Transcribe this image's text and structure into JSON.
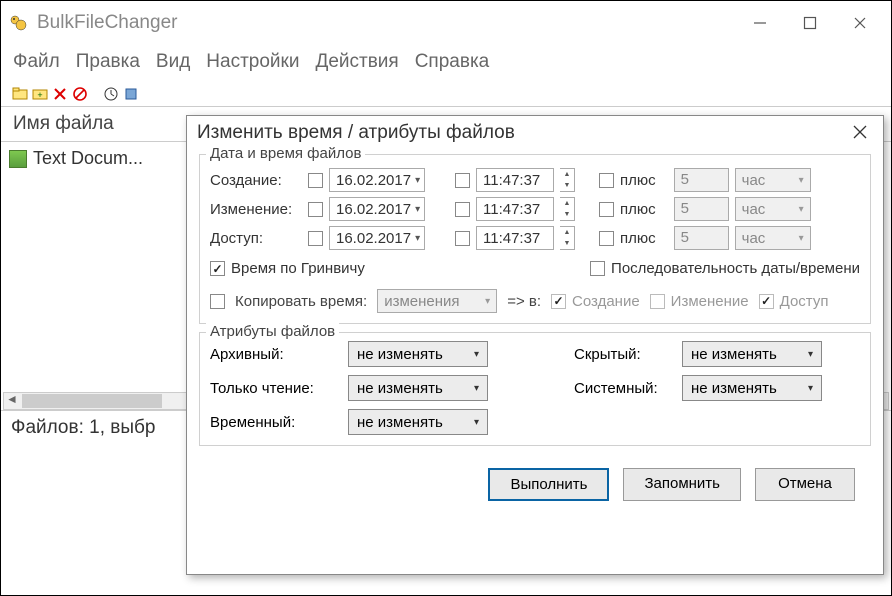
{
  "app": {
    "title": "BulkFileChanger"
  },
  "menu": {
    "file": "Файл",
    "edit": "Правка",
    "view": "Вид",
    "settings": "Настройки",
    "actions": "Действия",
    "help": "Справка"
  },
  "list": {
    "header_name": "Имя файла",
    "files": [
      {
        "name": "Text Docum..."
      }
    ]
  },
  "status": {
    "text": "Файлов: 1, выбр"
  },
  "dlg": {
    "title": "Изменить время / атрибуты файлов",
    "group_datetime": "Дата и время файлов",
    "labels": {
      "created": "Создание:",
      "modified": "Изменение:",
      "accessed": "Доступ:",
      "plus": "плюс"
    },
    "values": {
      "date": "16.02.2017",
      "time": "11:47:37",
      "offset": "5",
      "unit": "час"
    },
    "gmt": "Время по Гринвичу",
    "seq": "Последовательность даты/времени",
    "copy": {
      "label": "Копировать время:",
      "source": "изменения",
      "arrow": "=> в:",
      "c": "Создание",
      "m": "Изменение",
      "a": "Доступ"
    },
    "group_attrs": "Атрибуты файлов",
    "attrs": {
      "archive": "Архивный:",
      "readonly": "Только чтение:",
      "temporary": "Временный:",
      "hidden": "Скрытый:",
      "system": "Системный:",
      "value": "не изменять"
    },
    "buttons": {
      "execute": "Выполнить",
      "remember": "Запомнить",
      "cancel": "Отмена"
    }
  }
}
